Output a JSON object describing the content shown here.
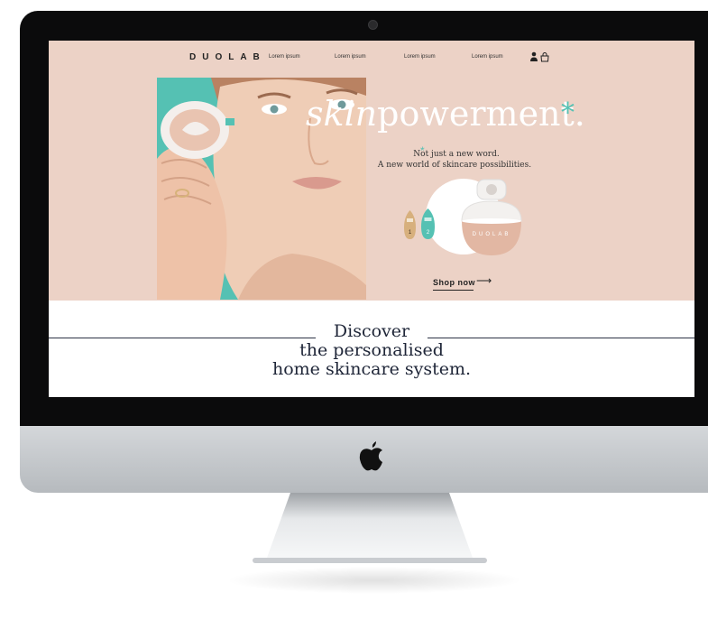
{
  "brand": {
    "logo": "DUOLAB"
  },
  "nav": {
    "links": [
      "Lorem ipsum",
      "Lorem ipsum",
      "Lorem ipsum",
      "Lorem ipsum"
    ]
  },
  "icons": {
    "user": "user-icon",
    "bag": "bag-icon",
    "apple": "apple-logo-icon"
  },
  "hero": {
    "headline_italic": "skin",
    "headline_rest": "powerment.",
    "asterisk": "*",
    "sub_line1": "Not just a new word.",
    "sub_line2": "A new world of skincare possibilities.",
    "capsule1_number": "1",
    "capsule2_number": "2",
    "device_label": "DUOLAB",
    "cta": "Shop now",
    "cta_arrow": "⟶"
  },
  "discover": {
    "line1": "Discover",
    "line2": "the personalised",
    "line3": "home skincare system."
  },
  "colors": {
    "page_bg": "#ecd2c6",
    "accent": "#55c1b3",
    "text_dark": "#1f2638"
  }
}
